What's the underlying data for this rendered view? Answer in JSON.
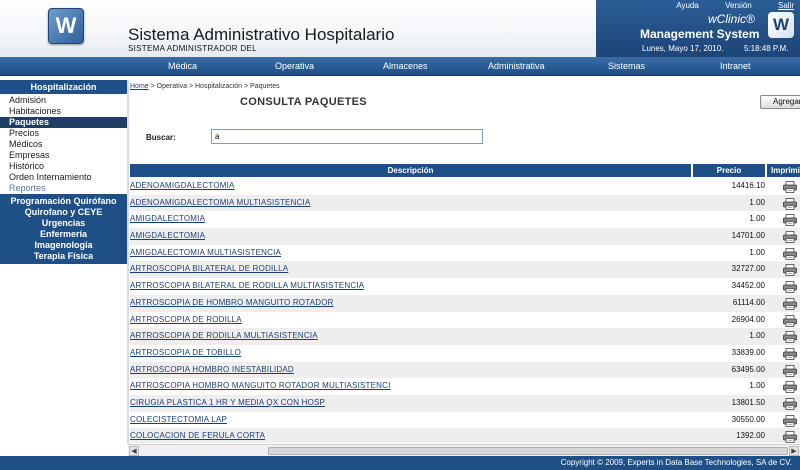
{
  "header": {
    "logo_letter": "W",
    "title": "Sistema Administrativo Hospitalario",
    "subtitle": "SISTEMA ADMINISTRADOR DEL",
    "top_links": [
      "Ayuda",
      "Versión",
      "Salir"
    ],
    "brand_name": "wClinic®",
    "brand_tagline": "Management System",
    "brand_logo_letter": "W",
    "date": "Lunes, Mayo 17, 2010.",
    "time": "5:18:48 P.M."
  },
  "nav": {
    "items": [
      "Médica",
      "Operativa",
      "Almacenes",
      "Administrativa",
      "Sistemas",
      "Intranet"
    ]
  },
  "sidebar": {
    "header": "Hospitalización",
    "items": [
      "Admisión",
      "Habitaciones",
      "Paquetes",
      "Precios",
      "Médicos",
      "Empresas",
      "Histórico",
      "Orden Internamiento",
      "Reportes"
    ],
    "active": "Paquetes",
    "sections": [
      "Programación Quirófano",
      "Quirofano y CEYE",
      "Urgencias",
      "Enfermería",
      "Imagenología",
      "Terapia Física"
    ]
  },
  "breadcrumb": {
    "home": "Home",
    "rest": " > Operativa > Hospitalización > Paquetes"
  },
  "page": {
    "title": "CONSULTA PAQUETES",
    "add_button": "Agregar"
  },
  "search": {
    "label": "Buscar:",
    "value": "a"
  },
  "table": {
    "columns": [
      "Descripción",
      "Precio",
      "Imprimir"
    ],
    "rows": [
      {
        "desc": "ADENOAMIGDALECTOMIA",
        "price": "14416.10"
      },
      {
        "desc": "ADENOAMIGDALECTOMIA MULTIASISTENCIA",
        "price": "1.00"
      },
      {
        "desc": "AMIGDALECTOMIA",
        "price": "1.00"
      },
      {
        "desc": "AMIGDALECTOMIA",
        "price": "14701.00"
      },
      {
        "desc": "AMIGDALECTOMIA MULTIASISTENCIA",
        "price": "1.00"
      },
      {
        "desc": "ARTROSCOPIA BILATERAL DE RODILLA",
        "price": "32727.00"
      },
      {
        "desc": "ARTROSCOPIA BILATERAL DE RODILLA MULTIASISTENCIA",
        "price": "34452.00"
      },
      {
        "desc": "ARTROSCOPIA DE HOMBRO MANGUITO ROTADOR",
        "price": "61114.00"
      },
      {
        "desc": "ARTROSCOPIA DE RODILLA",
        "price": "26904.00"
      },
      {
        "desc": "ARTROSCOPIA DE RODILLA MULTIASISTENCIA",
        "price": "1.00"
      },
      {
        "desc": "ARTROSCOPIA DE TOBILLO",
        "price": "33839.00"
      },
      {
        "desc": "ARTROSCOPIA HOMBRO INESTABILIDAD",
        "price": "63495.00"
      },
      {
        "desc": "ARTROSCOPIA HOMBRO MANGUITO ROTADOR MULTIASISTENCI",
        "price": "1.00"
      },
      {
        "desc": "CIRUGIA PLASTICA 1 HR Y MEDIA QX CON HOSP",
        "price": "13801.50"
      },
      {
        "desc": "COLECISTECTOMIA LAP",
        "price": "30550.00"
      },
      {
        "desc": "COLOCACION DE FERULA CORTA",
        "price": "1392.00"
      }
    ]
  },
  "footer": {
    "copyright": "Copyright © 2009, Experts in Data Base Technologies, SA de CV."
  },
  "colors": {
    "primary": "#1f4f87",
    "active": "#1f3e66",
    "link": "#1d3f6e",
    "row_alt": "#eeeeee"
  },
  "icons": {
    "print": "printer-icon"
  }
}
